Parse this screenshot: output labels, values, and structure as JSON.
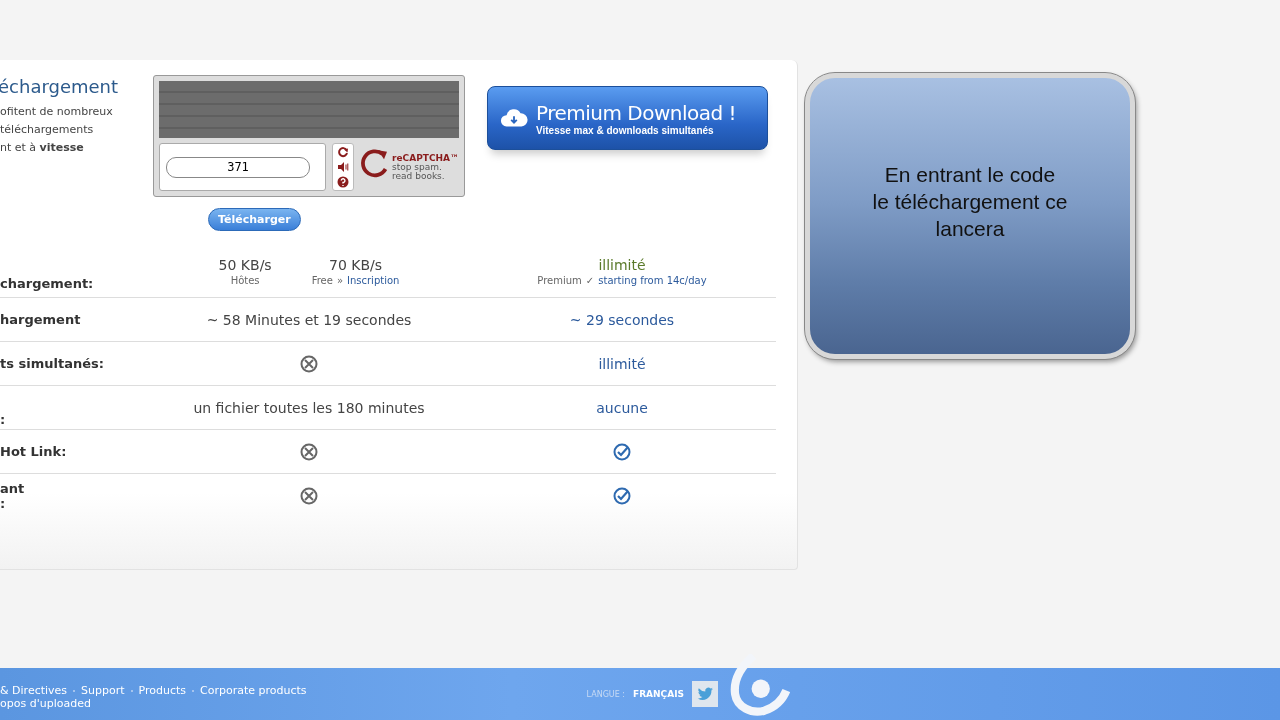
{
  "intro": {
    "title": "échargement",
    "lines": [
      "ofitent de nombreux",
      "téléchargements",
      "nt et à **vitesse**"
    ]
  },
  "captcha": {
    "value": "371",
    "logo_lines": [
      "reCAPTCHA™",
      "stop spam.",
      "read books."
    ]
  },
  "download_button": "Télécharger",
  "premium_button": {
    "title": "Premium Download !",
    "subtitle": "Vitesse max & downloads simultanés"
  },
  "table": {
    "header": {
      "label": [
        "chargement:"
      ],
      "free": [
        {
          "value": "50 KB/s",
          "note": "Hôtes"
        },
        {
          "value": "70 KB/s",
          "note": "Free",
          "sep": "»",
          "link": "Inscription"
        }
      ],
      "premium": {
        "value": "illimité",
        "note": "Premium",
        "mark": "✓",
        "link": "starting from 14c/day"
      }
    },
    "rows": [
      {
        "label": [
          "hargement"
        ],
        "free": {
          "kind": "text",
          "text": "~ 58 Minutes et 19 secondes"
        },
        "premium": {
          "kind": "text",
          "text": "~ 29 secondes"
        }
      },
      {
        "label": [
          "ts simultanés:"
        ],
        "free": {
          "kind": "cross"
        },
        "premium": {
          "kind": "text",
          "text": "illimité"
        }
      },
      {
        "label": [
          ":"
        ],
        "free": {
          "kind": "text",
          "text": "un fichier toutes les 180 minutes"
        },
        "premium": {
          "kind": "text",
          "text": "aucune"
        }
      },
      {
        "label": [
          "Hot Link:"
        ],
        "free": {
          "kind": "cross"
        },
        "premium": {
          "kind": "check"
        }
      },
      {
        "label": [
          "ant",
          ":"
        ],
        "free": {
          "kind": "cross"
        },
        "premium": {
          "kind": "check"
        }
      }
    ]
  },
  "callout": {
    "lines": [
      "En entrant le code",
      "le téléchargement ce",
      "lancera"
    ]
  },
  "footer": {
    "links": [
      "& Directives",
      "Support",
      "Products",
      "Corporate products"
    ],
    "second_line": "opos d'uploaded",
    "language_label": "LANGUE :",
    "language": "FRANÇAIS"
  }
}
